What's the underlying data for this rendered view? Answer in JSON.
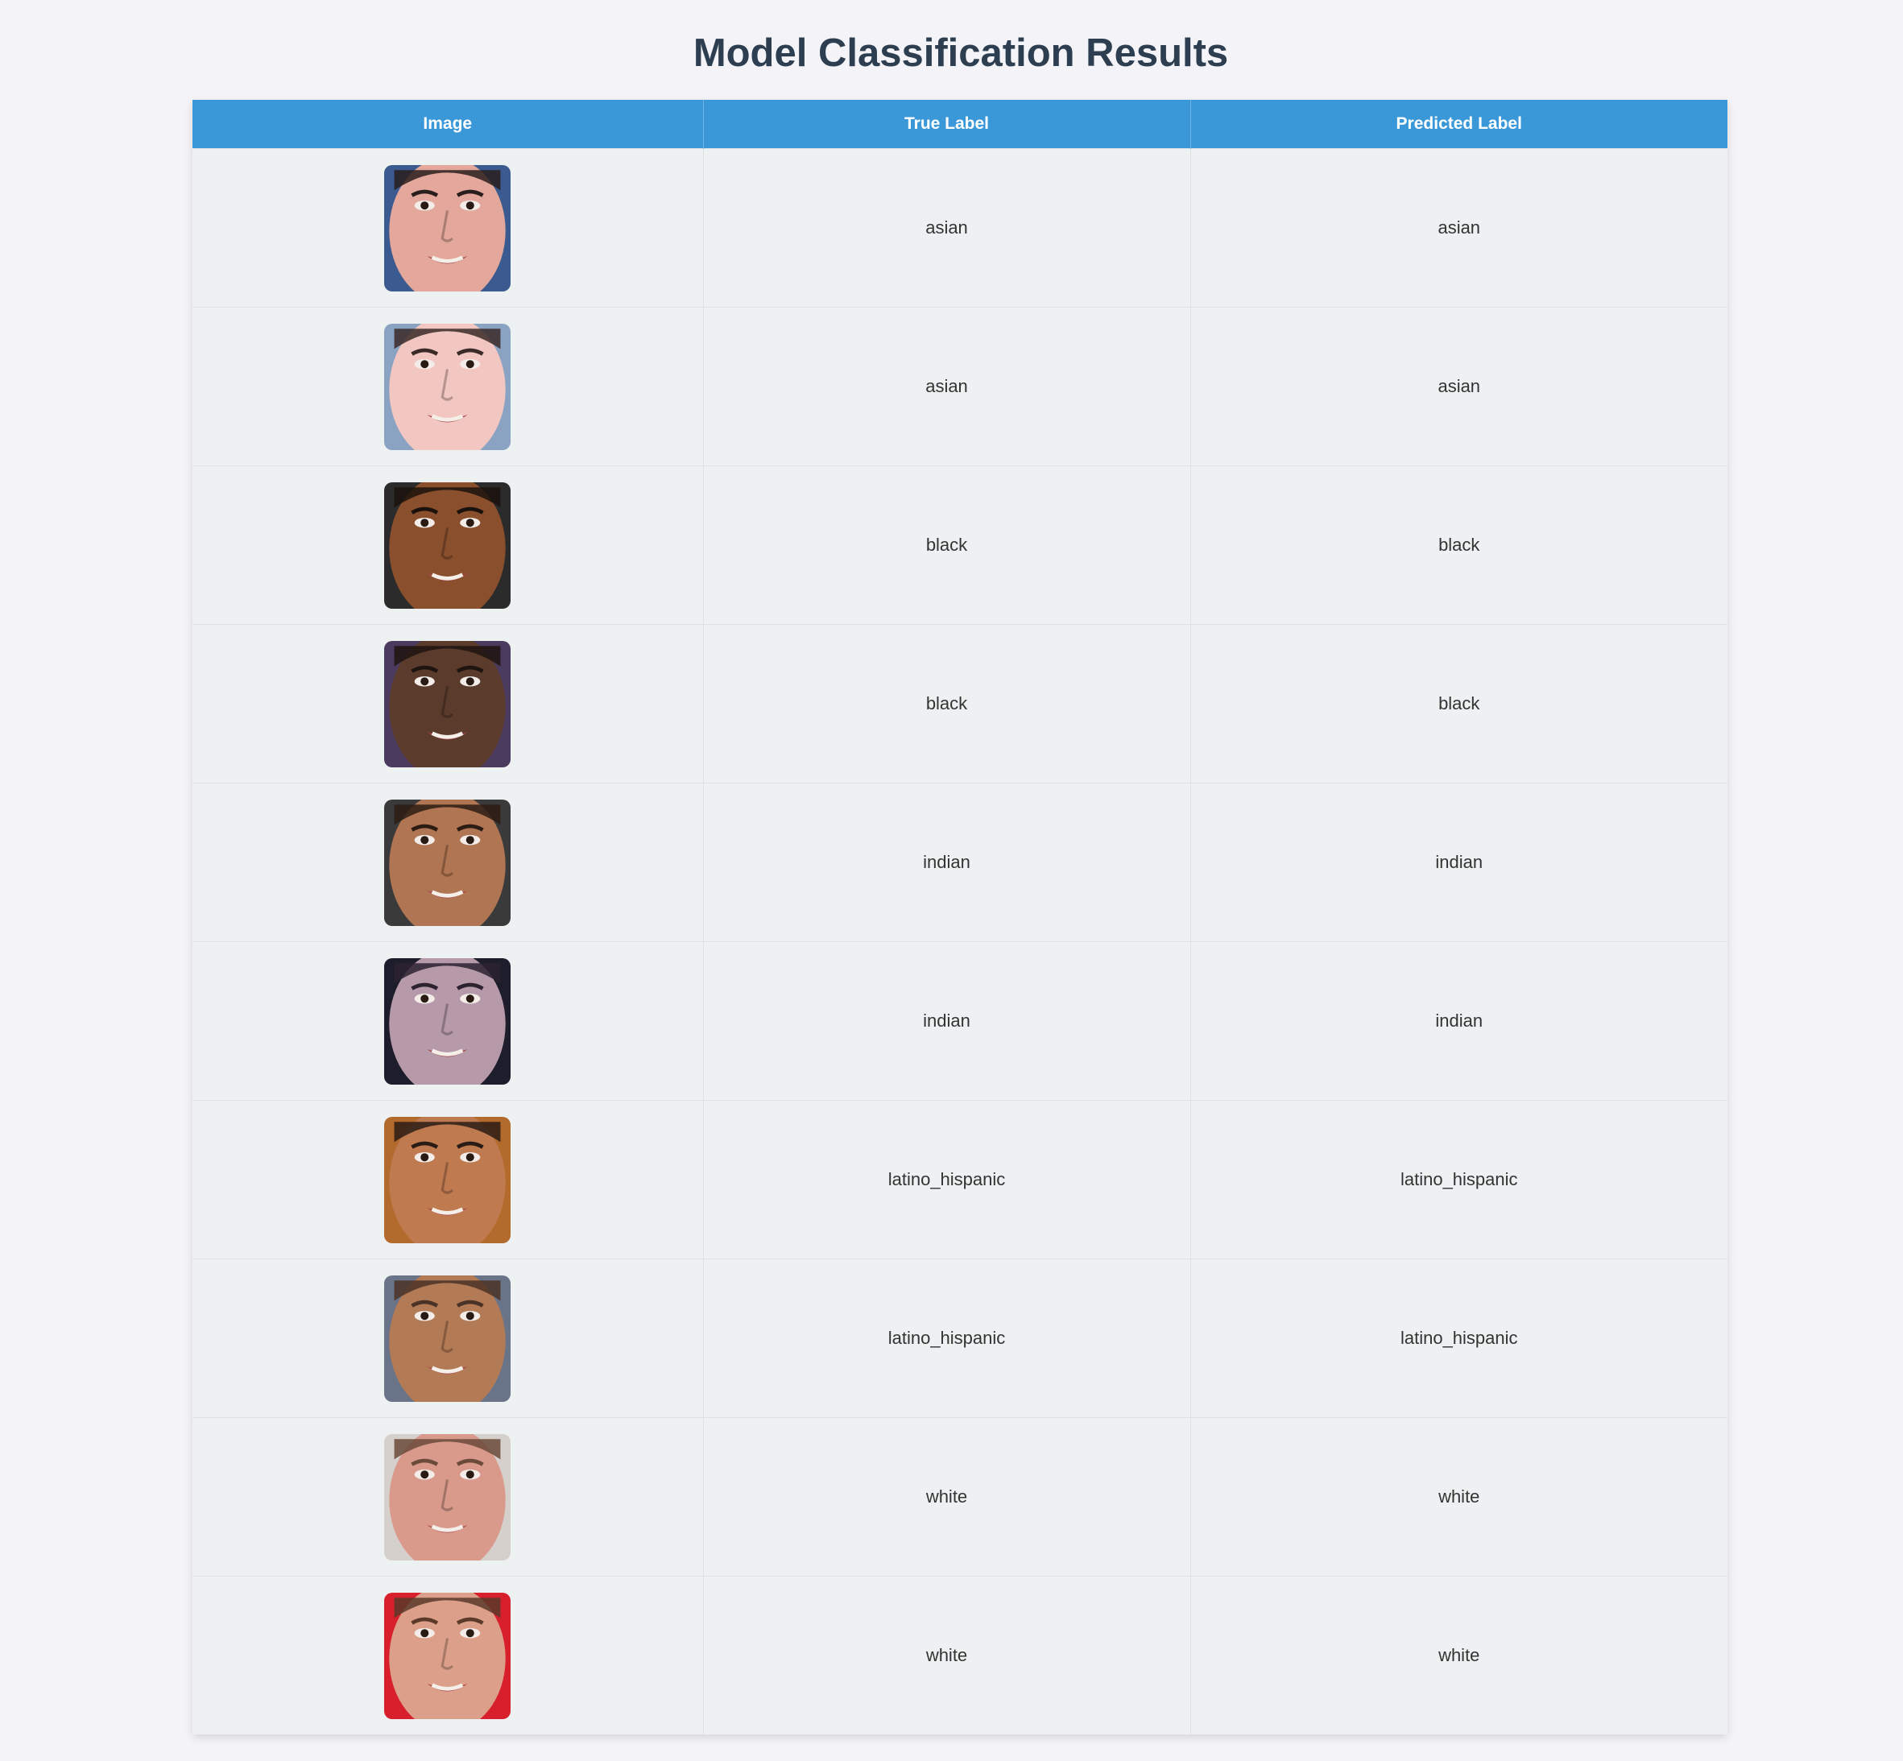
{
  "title": "Model Classification Results",
  "columns": {
    "image": "Image",
    "true_label": "True Label",
    "predicted_label": "Predicted Label"
  },
  "rows": [
    {
      "true": "asian",
      "pred": "asian",
      "skin": "#e3a79c",
      "hair": "#2a1e1d",
      "bg": "#3b5a8f"
    },
    {
      "true": "asian",
      "pred": "asian",
      "skin": "#f2c6c1",
      "hair": "#3a2a28",
      "bg": "#8aa3c2"
    },
    {
      "true": "black",
      "pred": "black",
      "skin": "#8a4f2c",
      "hair": "#1b120d",
      "bg": "#2b2b2b"
    },
    {
      "true": "black",
      "pred": "black",
      "skin": "#5a3b2c",
      "hair": "#1e1410",
      "bg": "#4a3a5e"
    },
    {
      "true": "indian",
      "pred": "indian",
      "skin": "#b07552",
      "hair": "#2d1c14",
      "bg": "#3a3a3a"
    },
    {
      "true": "indian",
      "pred": "indian",
      "skin": "#b79aa9",
      "hair": "#2c2230",
      "bg": "#1d1d2b"
    },
    {
      "true": "latino_hispanic",
      "pred": "latino_hispanic",
      "skin": "#c07a50",
      "hair": "#2a1c15",
      "bg": "#b36a2d"
    },
    {
      "true": "latino_hispanic",
      "pred": "latino_hispanic",
      "skin": "#b37a56",
      "hair": "#4a3326",
      "bg": "#6a7488"
    },
    {
      "true": "white",
      "pred": "white",
      "skin": "#d99a8c",
      "hair": "#6a4a3a",
      "bg": "#d6d0cc"
    },
    {
      "true": "white",
      "pred": "white",
      "skin": "#dca08a",
      "hair": "#5b3a2a",
      "bg": "#d8202d"
    }
  ]
}
